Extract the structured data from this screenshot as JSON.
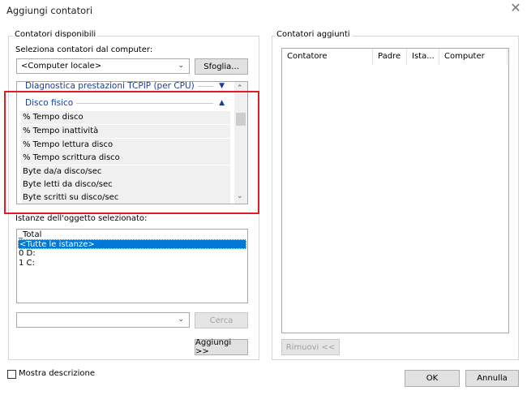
{
  "window": {
    "title": "Aggiungi contatori",
    "close_glyph": "✕"
  },
  "available": {
    "group_label": "Contatori disponibili",
    "computer_label": "Seleziona contatori dal computer:",
    "computer_value": "<Computer locale>",
    "browse_label": "Sfoglia...",
    "categories": {
      "above": "Diagnostica prestazioni TCPIP (per CPU)",
      "expanded": "Disco fisico"
    },
    "counters": [
      "% Tempo disco",
      "% Tempo inattività",
      "% Tempo lettura disco",
      "% Tempo scrittura disco",
      "Byte da/a disco/sec",
      "Byte letti da disco/sec",
      "Byte scritti su disco/sec"
    ],
    "instances_label": "Istanze dell'oggetto selezionato:",
    "instances": [
      "_Total",
      "<Tutte le istanze>",
      "0 D:",
      "1 C:"
    ],
    "selected_instance_index": 1,
    "search_value": "",
    "search_label": "Cerca",
    "add_label": "Aggiungi >>"
  },
  "added": {
    "group_label": "Contatori aggiunti",
    "columns": [
      "Contatore",
      "Padre",
      "Ista...",
      "Computer"
    ],
    "remove_label": "Rimuovi <<"
  },
  "footer": {
    "show_description_label": "Mostra descrizione",
    "show_description_checked": false,
    "ok_label": "OK",
    "cancel_label": "Annulla"
  },
  "colors": {
    "highlight_frame": "#e31b23",
    "selection": "#0078d7",
    "category_text": "#1a3e9e"
  }
}
